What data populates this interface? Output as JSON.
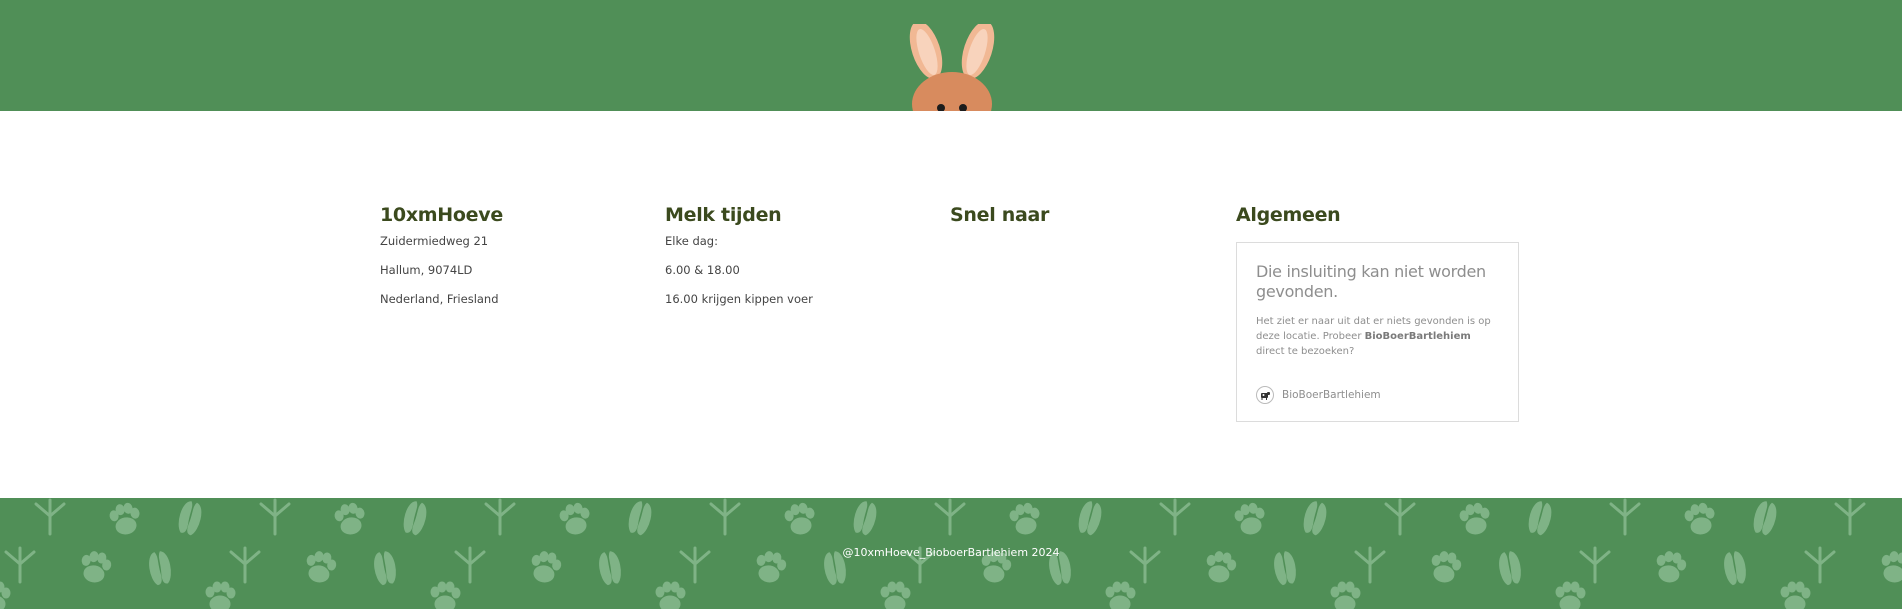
{
  "columns": [
    {
      "heading": "10xmHoeve",
      "lines": [
        "Zuidermiedweg 21",
        "Hallum, 9074LD",
        "Nederland, Friesland"
      ]
    },
    {
      "heading": "Melk tijden",
      "lines": [
        "Elke dag:",
        "6.00 & 18.00",
        "16.00 krijgen kippen voer"
      ]
    },
    {
      "heading": "Snel naar",
      "lines": []
    },
    {
      "heading": "Algemeen",
      "lines": []
    }
  ],
  "embed": {
    "title": "Die insluiting kan niet worden gevonden.",
    "body_before": "Het ziet er naar uit dat er niets gevonden is op deze locatie. Probeer ",
    "body_link": "BioBoerBartlehiem",
    "body_after": " direct te bezoeken?",
    "account_name": "BioBoerBartlehiem",
    "account_icon": "cow-avatar-icon"
  },
  "footer": {
    "copyright": "@10xmHoeve_BioboerBartlehiem 2024"
  },
  "colors": {
    "green": "#508f57",
    "heading": "#3b4a1e",
    "bunny": "#d88b5e",
    "bunny_inner_ear": "#f4c2a5"
  },
  "decor": {
    "top_mascot": "bunny-icon",
    "footer_pattern": [
      "paw-print-icon",
      "bird-track-icon",
      "hoof-print-icon"
    ]
  }
}
